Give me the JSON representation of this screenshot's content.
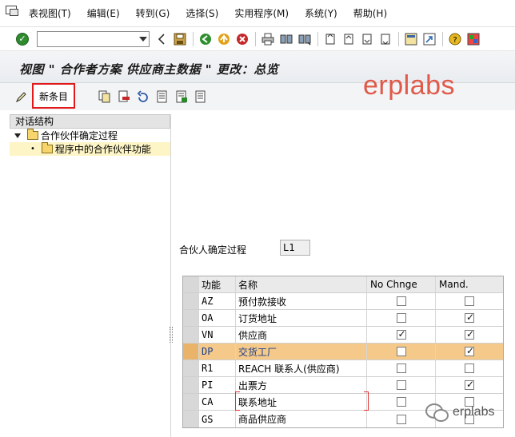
{
  "menu": {
    "items": [
      "表视图(T)",
      "编辑(E)",
      "转到(G)",
      "选择(S)",
      "实用程序(M)",
      "系统(Y)",
      "帮助(H)"
    ]
  },
  "toolbar": {
    "command_field_value": "",
    "icons": [
      "enter-icon",
      "back-arrow-icon",
      "save-icon",
      "back-icon",
      "exit-icon",
      "cancel-icon",
      "print-icon",
      "find-icon",
      "find-next-icon",
      "first-page-icon",
      "prev-page-icon",
      "next-page-icon",
      "last-page-icon",
      "new-session-icon",
      "shortcut-icon",
      "help-icon",
      "layout-icon"
    ]
  },
  "title": "视图 \" 合作者方案 供应商主数据 \" 更改：总览",
  "app_toolbar": {
    "new_entries_label": "新条目",
    "icons": [
      "change-display-icon",
      "copy-icon",
      "delete-icon",
      "undo-icon",
      "select-all-icon",
      "select-block-icon",
      "deselect-all-icon"
    ]
  },
  "watermark": "erplabs",
  "nav": {
    "header": "对话结构",
    "items": [
      {
        "label": "合作伙伴确定过程",
        "level": 1
      },
      {
        "label": "程序中的合作伙伴功能",
        "level": 2
      }
    ]
  },
  "field": {
    "label": "合伙人确定过程",
    "value": "L1"
  },
  "table": {
    "columns": [
      "功能",
      "名称",
      "No Chnge",
      "Mand."
    ],
    "rows": [
      {
        "code": "AZ",
        "name": "预付款接收",
        "no_change": false,
        "mandatory": false
      },
      {
        "code": "OA",
        "name": "订货地址",
        "no_change": false,
        "mandatory": true
      },
      {
        "code": "VN",
        "name": "供应商",
        "no_change": true,
        "mandatory": true
      },
      {
        "code": "DP",
        "name": "交货工厂",
        "no_change": false,
        "mandatory": true,
        "selected": true
      },
      {
        "code": "R1",
        "name": "REACH 联系人(供应商)",
        "no_change": false,
        "mandatory": false
      },
      {
        "code": "PI",
        "name": "出票方",
        "no_change": false,
        "mandatory": true
      },
      {
        "code": "CA",
        "name": "联系地址",
        "no_change": false,
        "mandatory": false
      },
      {
        "code": "GS",
        "name": "商品供应商",
        "no_change": false,
        "mandatory": false
      }
    ]
  },
  "footer_watermark": "erplabs",
  "colors": {
    "watermark": "#e05a4a",
    "highlight_row": "#f4c98a",
    "new_entries_border": "#e11a1a",
    "nav_selected": "#fdf5c6"
  }
}
